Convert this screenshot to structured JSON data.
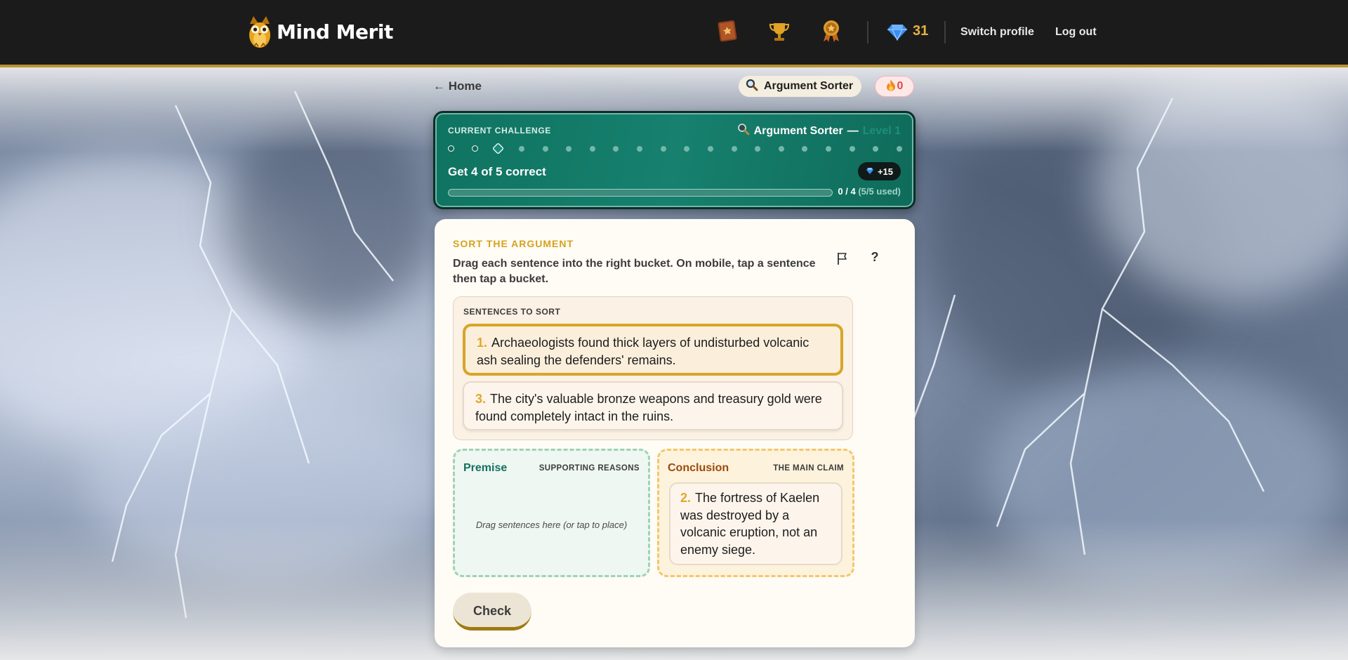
{
  "app": {
    "name": "Mind Merit"
  },
  "header": {
    "gems": "31",
    "switch_profile": "Switch profile",
    "logout": "Log out"
  },
  "nav": {
    "back": "← Home",
    "game_pill": "Argument Sorter",
    "streak": "0"
  },
  "challenge": {
    "label": "CURRENT CHALLENGE",
    "game": "Argument Sorter",
    "dash": "—",
    "level": "Level 1",
    "goal": "Get 4 of 5 correct",
    "reward": "+15",
    "progress_text": "0 / 4",
    "used_text": "(5/5 used)",
    "progress_fraction": 0
  },
  "task": {
    "kicker": "SORT THE ARGUMENT",
    "instruction": "Drag each sentence into the right bucket. On mobile, tap a sentence then tap a bucket.",
    "help": "?",
    "pool_label": "SENTENCES TO SORT",
    "sentences": [
      {
        "num": "1.",
        "text": "Archaeologists found thick layers of undisturbed volcanic ash sealing the defenders' remains."
      },
      {
        "num": "3.",
        "text": "The city's valuable bronze weapons and treasury gold were found completely intact in the ruins."
      }
    ],
    "premise": {
      "title": "Premise",
      "sub": "SUPPORTING REASONS",
      "hint": "Drag sentences here (or tap to place)"
    },
    "conclusion": {
      "title": "Conclusion",
      "sub": "THE MAIN CLAIM",
      "item_num": "2.",
      "item_text": "The fortress of Kaelen was destroyed by a volcanic eruption, not an enemy siege."
    },
    "check": "Check"
  }
}
